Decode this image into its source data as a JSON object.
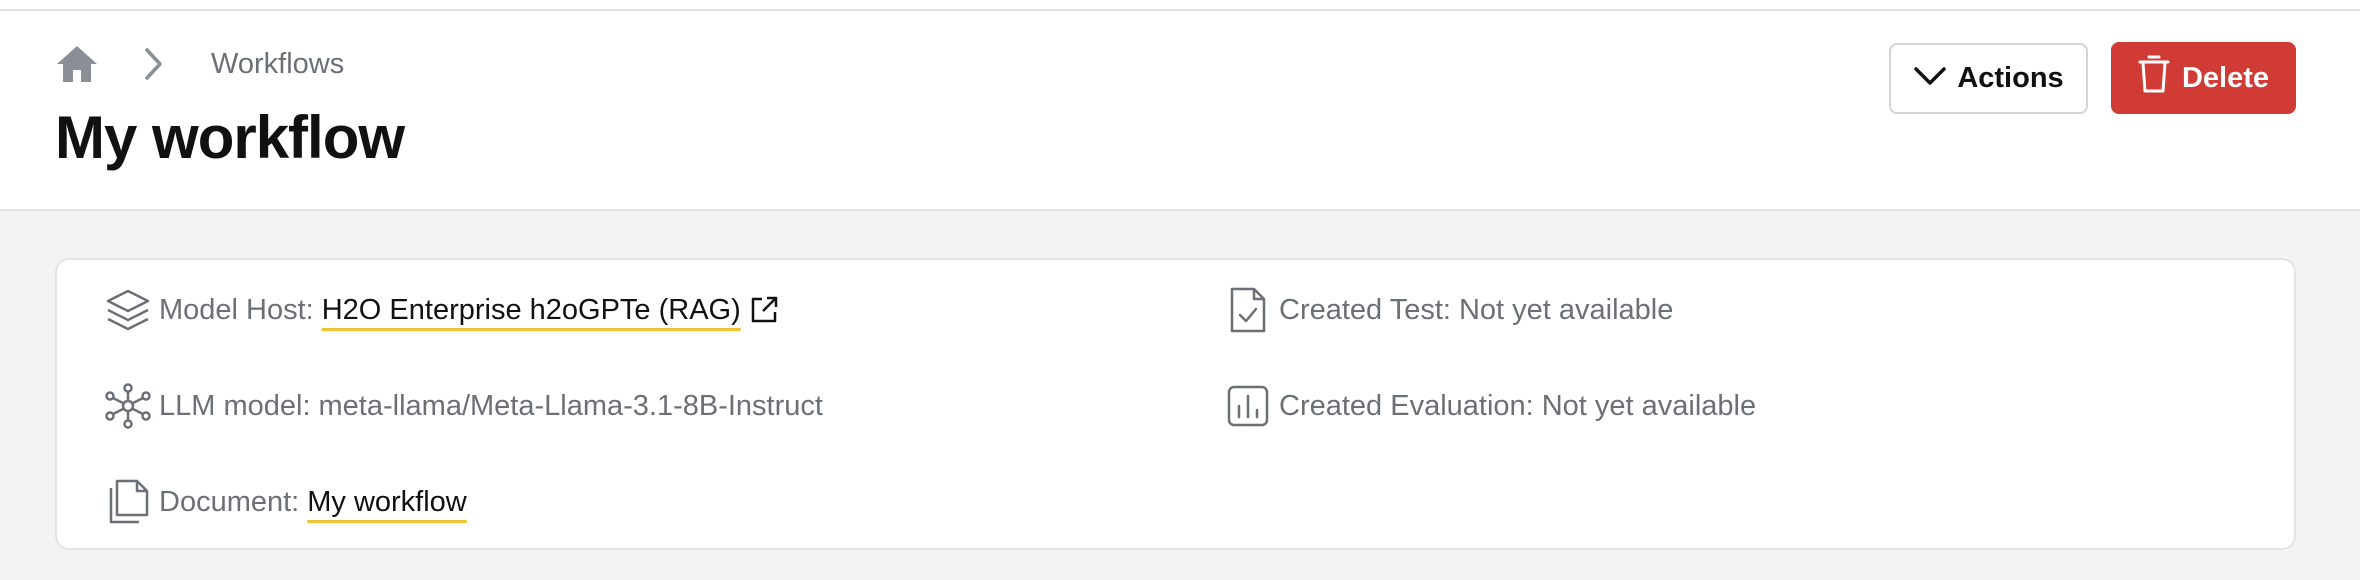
{
  "breadcrumb": {
    "home_icon": "home-icon",
    "separator_icon": "chevron-right-icon",
    "current": "Workflows"
  },
  "page": {
    "title": "My workflow"
  },
  "toolbar": {
    "actions_label": "Actions",
    "delete_label": "Delete"
  },
  "details": {
    "model_host": {
      "label": "Model Host:",
      "value": "H2O Enterprise h2oGPTe (RAG)",
      "icon": "layers-icon"
    },
    "llm_model": {
      "label": "LLM model:",
      "value": "meta-llama/Meta-Llama-3.1-8B-Instruct",
      "icon": "network-icon"
    },
    "document": {
      "label": "Document:",
      "value": "My workflow",
      "icon": "documents-icon"
    },
    "created_test": {
      "label": "Created Test:",
      "value": "Not yet available",
      "icon": "file-check-icon"
    },
    "created_evaluation": {
      "label": "Created Evaluation:",
      "value": "Not yet available",
      "icon": "bar-chart-icon"
    }
  },
  "colors": {
    "accent_underline": "#f1c232",
    "danger": "#d03b36",
    "muted_text": "#6b6f76"
  }
}
